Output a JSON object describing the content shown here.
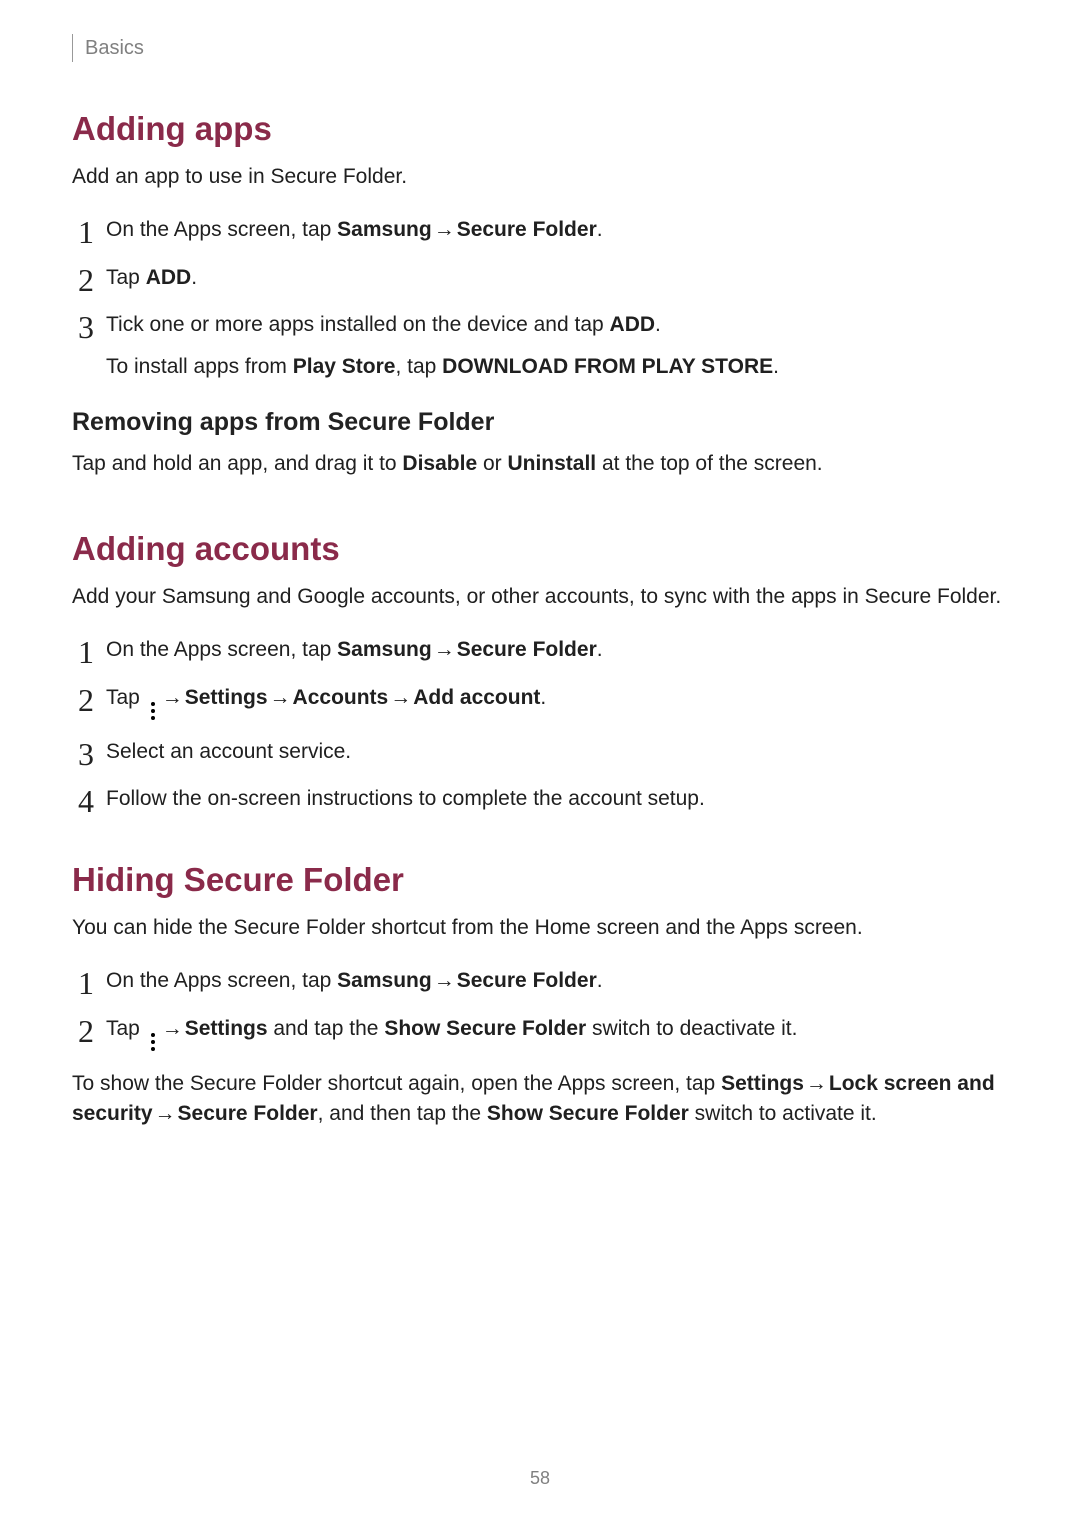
{
  "header": {
    "section": "Basics"
  },
  "page_number": "58",
  "s1": {
    "title": "Adding apps",
    "lead": "Add an app to use in Secure Folder.",
    "step1_a": "On the Apps screen, tap ",
    "step1_b": "Samsung",
    "step1_c": "Secure Folder",
    "step1_d": ".",
    "step2_a": "Tap ",
    "step2_b": "ADD",
    "step2_c": ".",
    "step3_a": "Tick one or more apps installed on the device and tap ",
    "step3_b": "ADD",
    "step3_c": ".",
    "step3_ex_a": "To install apps from ",
    "step3_ex_b": "Play Store",
    "step3_ex_c": ", tap ",
    "step3_ex_d": "DOWNLOAD FROM PLAY STORE",
    "step3_ex_e": ".",
    "sub_title": "Removing apps from Secure Folder",
    "sub_a": "Tap and hold an app, and drag it to ",
    "sub_b": "Disable",
    "sub_c": " or ",
    "sub_d": "Uninstall",
    "sub_e": " at the top of the screen."
  },
  "s2": {
    "title": "Adding accounts",
    "lead": "Add your Samsung and Google accounts, or other accounts, to sync with the apps in Secure Folder.",
    "step1_a": "On the Apps screen, tap ",
    "step1_b": "Samsung",
    "step1_c": "Secure Folder",
    "step1_d": ".",
    "step2_a": "Tap ",
    "step2_b": "Settings",
    "step2_c": "Accounts",
    "step2_d": "Add account",
    "step2_e": ".",
    "step3": "Select an account service.",
    "step4": "Follow the on-screen instructions to complete the account setup."
  },
  "s3": {
    "title": "Hiding Secure Folder",
    "lead": "You can hide the Secure Folder shortcut from the Home screen and the Apps screen.",
    "step1_a": "On the Apps screen, tap ",
    "step1_b": "Samsung",
    "step1_c": "Secure Folder",
    "step1_d": ".",
    "step2_a": "Tap ",
    "step2_b": "Settings",
    "step2_c": " and tap the ",
    "step2_d": "Show Secure Folder",
    "step2_e": " switch to deactivate it.",
    "tail_a": "To show the Secure Folder shortcut again, open the Apps screen, tap ",
    "tail_b": "Settings",
    "tail_c": "Lock screen and security",
    "tail_d": "Secure Folder",
    "tail_e": ", and then tap the ",
    "tail_f": "Show Secure Folder",
    "tail_g": " switch to activate it."
  },
  "glyphs": {
    "arrow": "→"
  }
}
